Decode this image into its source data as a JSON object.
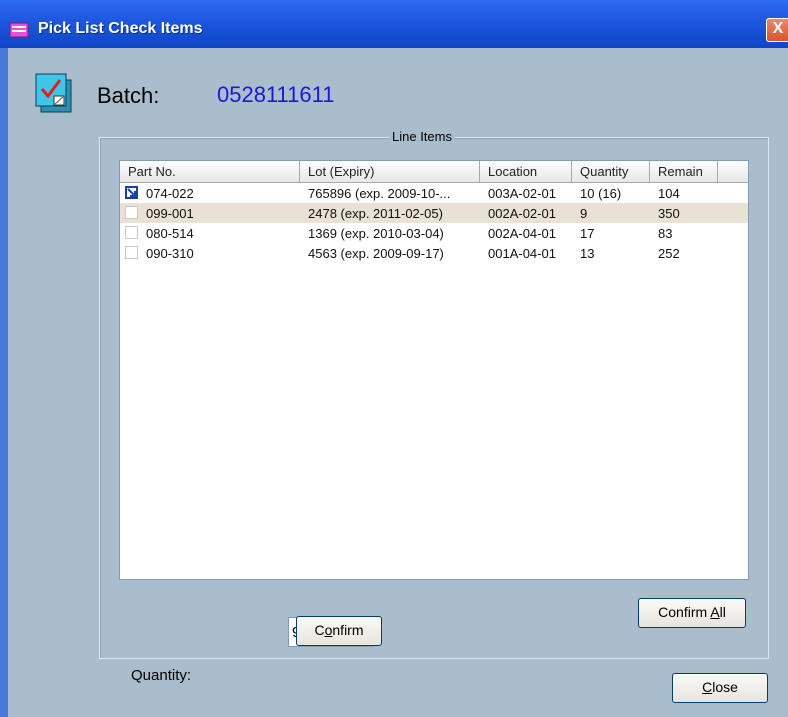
{
  "window": {
    "title": "Pick List Check Items",
    "close_glyph": "X"
  },
  "batch": {
    "label": "Batch:",
    "value": "0528111611"
  },
  "line_items": {
    "group_title": "Line Items",
    "columns": [
      "Part No.",
      "Lot (Expiry)",
      "Location",
      "Quantity",
      "Remain"
    ],
    "rows": [
      {
        "part": "074-022",
        "lot": "765896 (exp. 2009-10-...",
        "location": "003A-02-01",
        "quantity": "10 (16)",
        "remain": "104",
        "checked": true,
        "selected": false
      },
      {
        "part": "099-001",
        "lot": "2478 (exp. 2011-02-05)",
        "location": "002A-02-01",
        "quantity": "9",
        "remain": "350",
        "checked": false,
        "selected": true
      },
      {
        "part": "080-514",
        "lot": "1369 (exp. 2010-03-04)",
        "location": "002A-04-01",
        "quantity": "17",
        "remain": "83",
        "checked": false,
        "selected": false
      },
      {
        "part": "090-310",
        "lot": "4563 (exp. 2009-09-17)",
        "location": "001A-04-01",
        "quantity": "13",
        "remain": "252",
        "checked": false,
        "selected": false
      }
    ]
  },
  "quantity": {
    "label": "Quantity:",
    "value": "9"
  },
  "buttons": {
    "confirm": {
      "pre": "C",
      "accel": "o",
      "post": "nfirm"
    },
    "confirm_all": {
      "pre": "Confirm ",
      "accel": "A",
      "post": "ll"
    },
    "close": {
      "pre": "",
      "accel": "C",
      "post": "lose"
    }
  },
  "colors": {
    "title_bar": "#1e58e0",
    "client_bg": "#a9bdcc",
    "batch_value": "#1a1ad6",
    "selected_row": "#e8e1d4"
  }
}
